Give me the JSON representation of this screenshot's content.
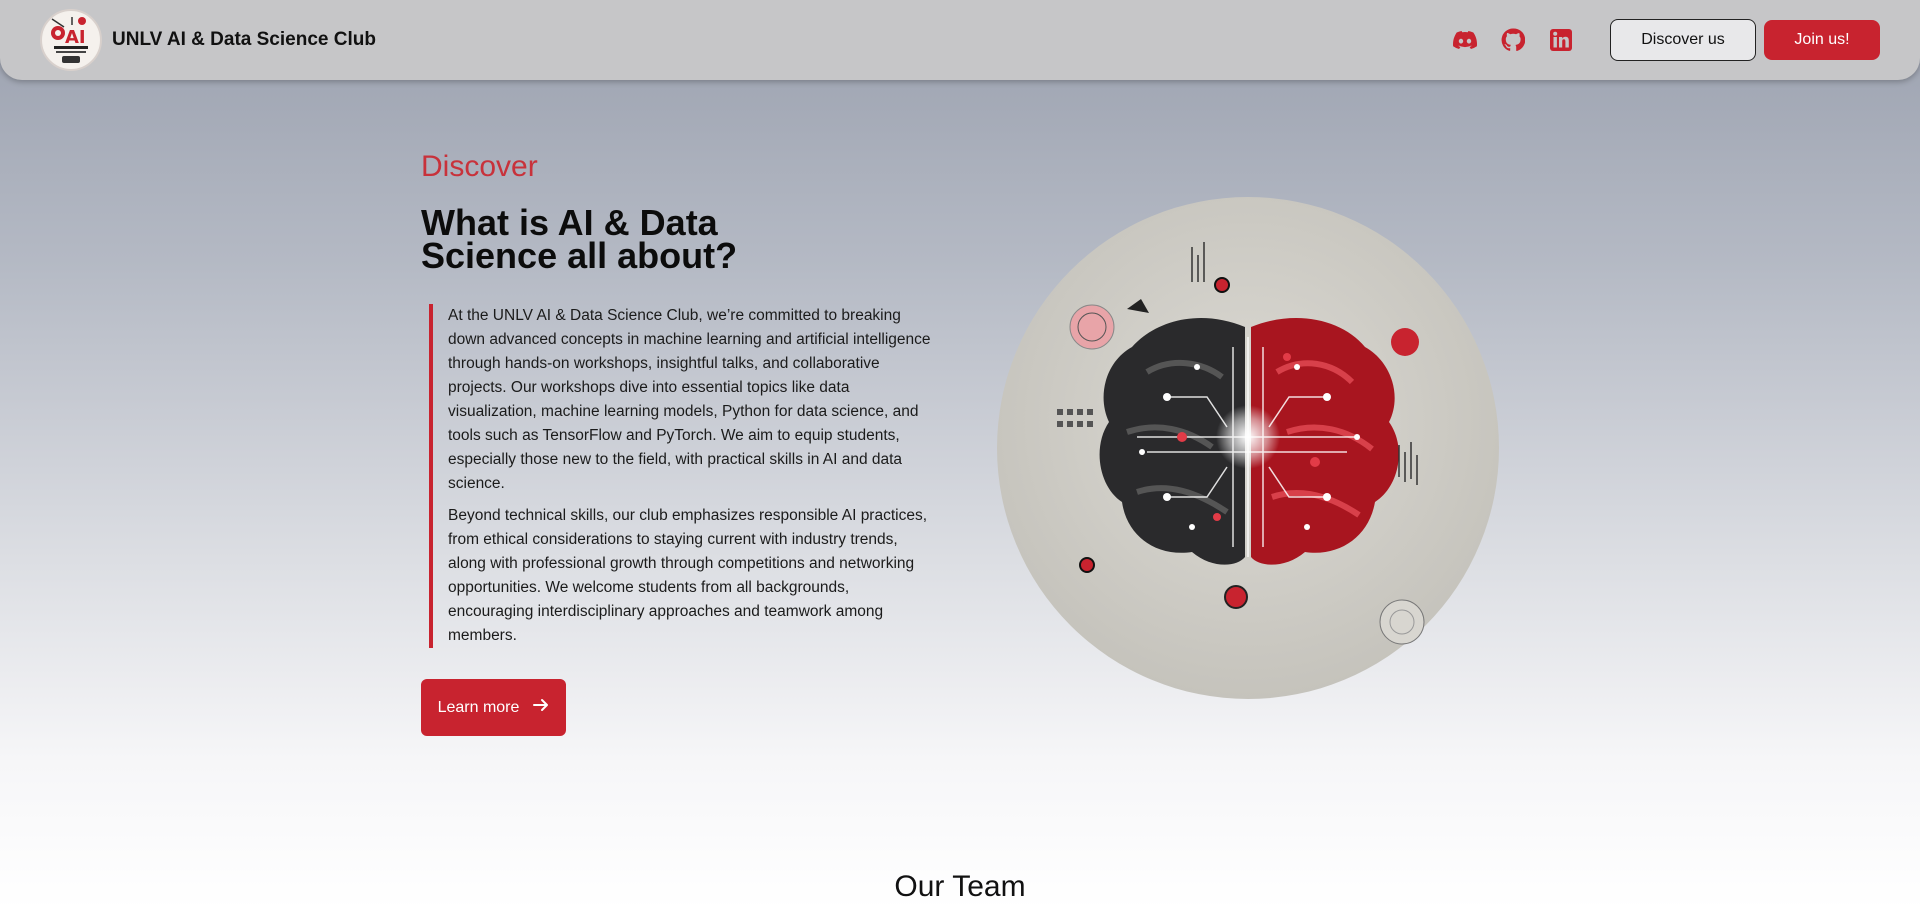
{
  "nav": {
    "brand": "UNLV AI & Data Science Club",
    "logo_icon": "club-logo-icon",
    "social": [
      {
        "name": "discord-icon",
        "color": "#c8232f"
      },
      {
        "name": "github-icon",
        "color": "#c8232f"
      },
      {
        "name": "linkedin-icon",
        "color": "#c8232f"
      }
    ],
    "discover_label": "Discover us",
    "join_label": "Join us!"
  },
  "hero": {
    "eyebrow": "Discover",
    "headline": "What is AI & Data Science all about?",
    "paragraphs": [
      "At the UNLV AI & Data Science Club, we’re committed to breaking down advanced concepts in machine learning and artificial intelligence through hands-on workshops, insightful talks, and collaborative projects. Our workshops dive into essential topics like data visualization, machine learning models, Python for data science, and tools such as TensorFlow and PyTorch. We aim to equip students, especially those new to the field, with practical skills in AI and data science.",
      "Beyond technical skills, our club emphasizes responsible AI practices, from ethical considerations to staying current with industry trends, along with professional growth through competitions and networking opportunities. We welcome students from all backgrounds, encouraging interdisciplinary approaches and teamwork among members."
    ],
    "learn_more_label": "Learn more",
    "learn_more_icon": "arrow-right-icon",
    "image": "ai-brain-illustration"
  },
  "team": {
    "title": "Our Team"
  },
  "colors": {
    "accent": "#c8232f",
    "navbar": "#c6c6c8"
  }
}
